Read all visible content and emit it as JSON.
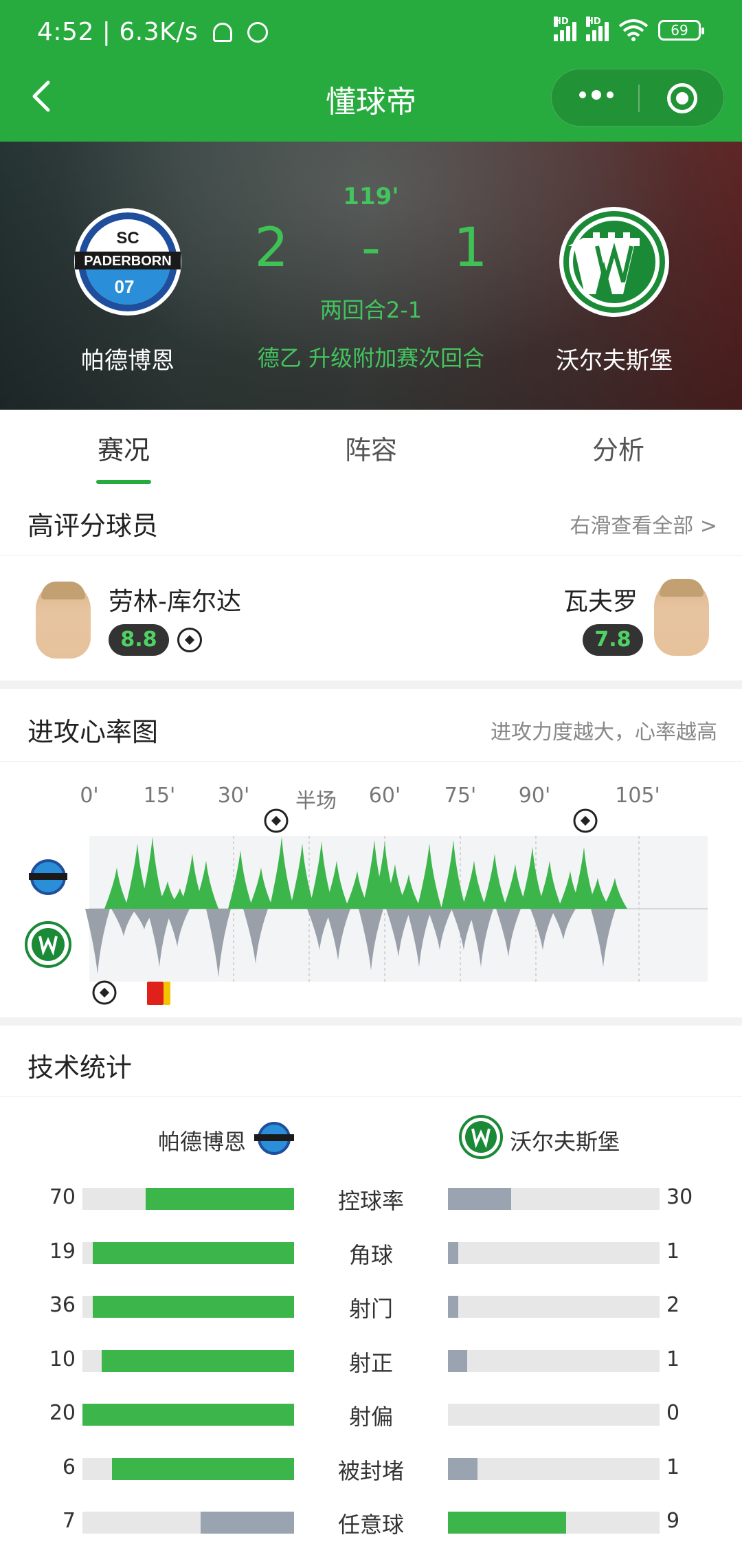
{
  "status": {
    "time_speed": "4:52 | 6.3K/s",
    "battery": "69",
    "hd": "HD"
  },
  "nav": {
    "title": "懂球帝"
  },
  "match": {
    "minute": "119'",
    "home_score": "2",
    "separator": "-",
    "away_score": "1",
    "aggregate": "两回合2-1",
    "competition": "德乙 升级附加赛次回合",
    "home_team": "帕德博恩",
    "away_team": "沃尔夫斯堡",
    "home_logo_text": {
      "line1": "SC",
      "line2": "PADERBORN",
      "line3": "07"
    }
  },
  "tabs": [
    "赛况",
    "阵容",
    "分析"
  ],
  "top_players": {
    "title": "高评分球员",
    "more": "右滑查看全部 >",
    "home": {
      "name": "劳林-库尔达",
      "rating": "8.8"
    },
    "away": {
      "name": "瓦夫罗",
      "rating": "7.8"
    }
  },
  "heart_chart": {
    "title": "进攻心率图",
    "note": "进攻力度越大，心率越高",
    "ticks": [
      "0'",
      "15'",
      "30'",
      "半场",
      "60'",
      "75'",
      "90'",
      "105'"
    ],
    "home_color": "#3cb64b",
    "away_color": "#9aa0aa"
  },
  "tech_stats": {
    "title": "技术统计",
    "home_team": "帕德博恩",
    "away_team": "沃尔夫斯堡",
    "home_color": "#3cb64b",
    "away_color": "#9aa3b0",
    "rows": [
      {
        "label": "控球率",
        "home": "70",
        "away": "30",
        "home_frac": 0.7,
        "away_frac": 0.3,
        "winner": "home"
      },
      {
        "label": "角球",
        "home": "19",
        "away": "1",
        "home_frac": 0.95,
        "away_frac": 0.05,
        "winner": "home"
      },
      {
        "label": "射门",
        "home": "36",
        "away": "2",
        "home_frac": 0.95,
        "away_frac": 0.05,
        "winner": "home"
      },
      {
        "label": "射正",
        "home": "10",
        "away": "1",
        "home_frac": 0.91,
        "away_frac": 0.09,
        "winner": "home"
      },
      {
        "label": "射偏",
        "home": "20",
        "away": "0",
        "home_frac": 1.0,
        "away_frac": 0.0,
        "winner": "home"
      },
      {
        "label": "被封堵",
        "home": "6",
        "away": "1",
        "home_frac": 0.86,
        "away_frac": 0.14,
        "winner": "home"
      },
      {
        "label": "任意球",
        "home": "7",
        "away": "9",
        "home_frac": 0.44,
        "away_frac": 0.56,
        "winner": "away"
      }
    ]
  }
}
